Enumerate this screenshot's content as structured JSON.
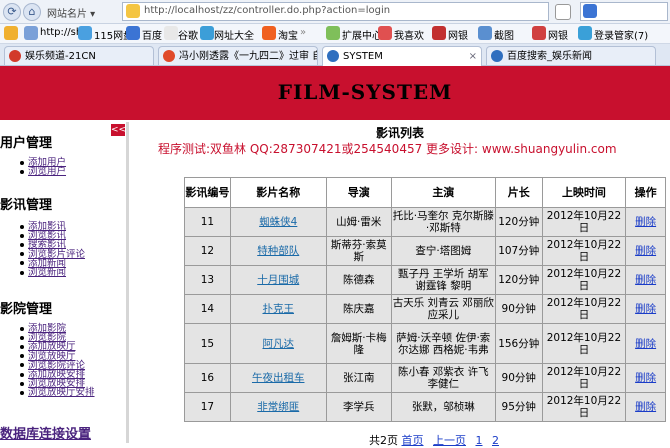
{
  "browser": {
    "address_menu": "网站名片",
    "url": "http://localhost/zz/controller.do.php?action=login",
    "favorites": [
      "http://sh",
      "115网盘",
      "百度",
      "谷歌",
      "网址大全",
      "淘宝",
      "扩展中心",
      "我喜欢",
      "网银",
      "截图",
      "网银",
      "登录管家(7)"
    ],
    "tabs": [
      {
        "label": "娱乐频道-21CN",
        "color": "#d23a2a"
      },
      {
        "label": "冯小刚透露《一九四二》过审 自...",
        "color": "#e04a2a"
      },
      {
        "label": "SYSTEM",
        "color": "#2f6fbf"
      },
      {
        "label": "百度搜索_娱乐新闻",
        "color": "#2f6fbf"
      }
    ]
  },
  "banner": {
    "title": "FILM-SYSTEM"
  },
  "sidebar": {
    "collapse": "<<",
    "sections": [
      {
        "title": "用户管理",
        "items": [
          "添加用户",
          "浏览用户"
        ]
      },
      {
        "title": "影讯管理",
        "items": [
          "添加影讯",
          "浏览影讯",
          "搜索影讯",
          "浏览影片评论",
          "添加新闻",
          "浏览新闻"
        ]
      },
      {
        "title": "影院管理",
        "items": [
          "添加影院",
          "浏览影院",
          "添加放映厅",
          "浏览放映厅",
          "浏览影院评论",
          "添加放映安排",
          "浏览放映安排",
          "浏览放映厅安排"
        ]
      }
    ],
    "db_link": "数据库连接设置"
  },
  "main": {
    "heading": "影讯列表",
    "credit": "程序测试:双鱼林 QQ:287307421或254540457 更多设计: www.shuangyulin.com",
    "columns": [
      "影讯编号",
      "影片名称",
      "导演",
      "主演",
      "片长",
      "上映时间",
      "操作"
    ],
    "rows": [
      {
        "id": "11",
        "name": "蜘蛛侠4",
        "director": "山姆·雷米",
        "cast": "托比·马奎尔 克尔斯滕·邓斯特",
        "length": "120分钟",
        "date": "2012年10月22日",
        "op": "删除"
      },
      {
        "id": "12",
        "name": "特种部队",
        "director": "斯蒂芬·索莫斯",
        "cast": "查宁·塔图姆",
        "length": "107分钟",
        "date": "2012年10月22日",
        "op": "删除"
      },
      {
        "id": "13",
        "name": "十月围城",
        "director": "陈德森",
        "cast": "甄子丹 王学圻 胡军 谢霆锋 黎明",
        "length": "120分钟",
        "date": "2012年10月22日",
        "op": "删除"
      },
      {
        "id": "14",
        "name": "扑克王",
        "director": "陈庆嘉",
        "cast": "古天乐 刘青云 邓丽欣 应采儿",
        "length": "90分钟",
        "date": "2012年10月22日",
        "op": "删除"
      },
      {
        "id": "15",
        "name": "阿凡达",
        "director": "詹姆斯·卡梅隆",
        "cast": "萨姆·沃辛顿 佐伊·索尔达娜 西格妮·韦弗",
        "length": "156分钟",
        "date": "2012年10月22日",
        "op": "删除"
      },
      {
        "id": "16",
        "name": "午夜出租车",
        "director": "张江南",
        "cast": "陈小春 邓紫衣 许飞 李健仁",
        "length": "90分钟",
        "date": "2012年10月22日",
        "op": "删除"
      },
      {
        "id": "17",
        "name": "非常绑匪",
        "director": "李学兵",
        "cast": "张默，邬桢琳",
        "length": "95分钟",
        "date": "2012年10月22日",
        "op": "删除"
      }
    ],
    "pager": {
      "total": "共2页",
      "first": "首页",
      "prev": "上一页",
      "p1": "1",
      "p2": "2"
    }
  }
}
